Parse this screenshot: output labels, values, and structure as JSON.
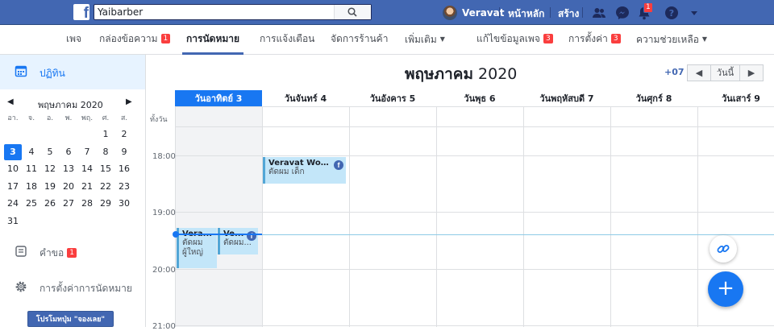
{
  "topbar": {
    "search_value": "Yaibarber",
    "user_name": "Veravat",
    "home": "หน้าหลัก",
    "create": "สร้าง",
    "notif_count": "1"
  },
  "pagenav": {
    "items": [
      {
        "label": "เพจ"
      },
      {
        "label": "กล่องข้อความ",
        "badge": "1"
      },
      {
        "label": "การนัดหมาย"
      },
      {
        "label": "การแจ้งเตือน"
      },
      {
        "label": "จัดการร้านค้า"
      },
      {
        "label": "เพิ่มเติม"
      },
      {
        "label": "แก้ไขข้อมูลเพจ",
        "badge": "3"
      },
      {
        "label": "การตั้งค่า",
        "badge": "3"
      },
      {
        "label": "ความช่วยเหลือ"
      }
    ]
  },
  "sidebar": {
    "calendar_label": "ปฏิทิน",
    "mini_month": "พฤษภาคม 2020",
    "weekdays": [
      "อา.",
      "จ.",
      "อ.",
      "พ.",
      "พฤ.",
      "ศ.",
      "ส."
    ],
    "days": [
      "1",
      "2",
      "3",
      "4",
      "5",
      "6",
      "7",
      "8",
      "9",
      "10",
      "11",
      "12",
      "13",
      "14",
      "15",
      "16",
      "17",
      "18",
      "19",
      "20",
      "21",
      "22",
      "23",
      "24",
      "25",
      "26",
      "27",
      "28",
      "29",
      "30",
      "31"
    ],
    "selected_day": "3",
    "requests_label": "คำขอ",
    "requests_badge": "1",
    "settings_label": "การตั้งค่าการนัดหมาย",
    "promo_label": "โปรโมทปุ่ม \"จองเลย\""
  },
  "calendar": {
    "month": "พฤษภาคม",
    "year": "2020",
    "timezone": "+07",
    "today_btn": "วันนี้",
    "columns": [
      "วันอาทิตย์ 3",
      "วันจันทร์ 4",
      "วันอังคาร 5",
      "วันพุธ 6",
      "วันพฤหัสบดี 7",
      "วันศุกร์ 8",
      "วันเสาร์ 9"
    ],
    "allday_label": "ทั้งวัน",
    "hours": [
      "18:00",
      "19:00",
      "20:00",
      "21:00"
    ],
    "events": [
      {
        "name": "Veravat Won...",
        "service": "ตัดผม เด็ก"
      },
      {
        "name": "Vera...",
        "service": "ตัดผม ผู้ใหญ่"
      },
      {
        "name": "Ve...",
        "service": "ตัดผม..."
      }
    ]
  },
  "icons": {
    "link": "link-icon",
    "add": "plus-icon"
  },
  "colors": {
    "brand": "#4267b2",
    "accent": "#1877f2",
    "badge": "#fa3e3e",
    "event": "#c3e6f9"
  }
}
